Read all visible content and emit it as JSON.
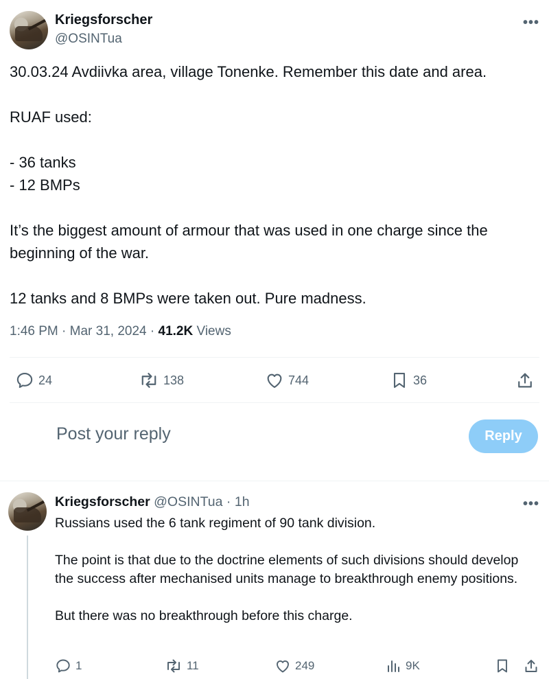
{
  "tweet": {
    "author_name": "Kriegsforscher",
    "author_handle": "@OSINTua",
    "more_label": "•••",
    "lines": [
      "30.03.24 Avdiivka area, village Tonenke. Remember this date and area.",
      "",
      "RUAF used:",
      "",
      "- 36 tanks",
      "- 12 BMPs",
      "",
      "It’s the biggest amount of armour that was used in one charge since the beginning of the war.",
      "",
      "12 tanks and 8 BMPs were taken out. Pure madness."
    ],
    "time": "1:46 PM",
    "date": "Mar 31, 2024",
    "views_count": "41.2K",
    "views_label": "Views",
    "separator": "·",
    "stats": {
      "replies": "24",
      "reposts": "138",
      "likes": "744",
      "bookmarks": "36"
    }
  },
  "reply_composer": {
    "placeholder": "Post your reply",
    "button_label": "Reply"
  },
  "reply": {
    "author_name": "Kriegsforscher",
    "author_handle": "@OSINTua",
    "separator": "·",
    "time_ago": "1h",
    "more_label": "•••",
    "lines": [
      "Russians used the 6 tank regiment of 90 tank division.",
      "",
      "The point is that due to the doctrine elements of such divisions should develop the success after mechanised units manage to breakthrough enemy positions.",
      "",
      "But there was no breakthrough before this charge."
    ],
    "stats": {
      "replies": "1",
      "reposts": "11",
      "likes": "249",
      "views": "9K"
    }
  },
  "colors": {
    "text_primary": "#0f1419",
    "text_secondary": "#536471",
    "reply_button": "#8ecdf8",
    "divider": "#eff3f4"
  }
}
